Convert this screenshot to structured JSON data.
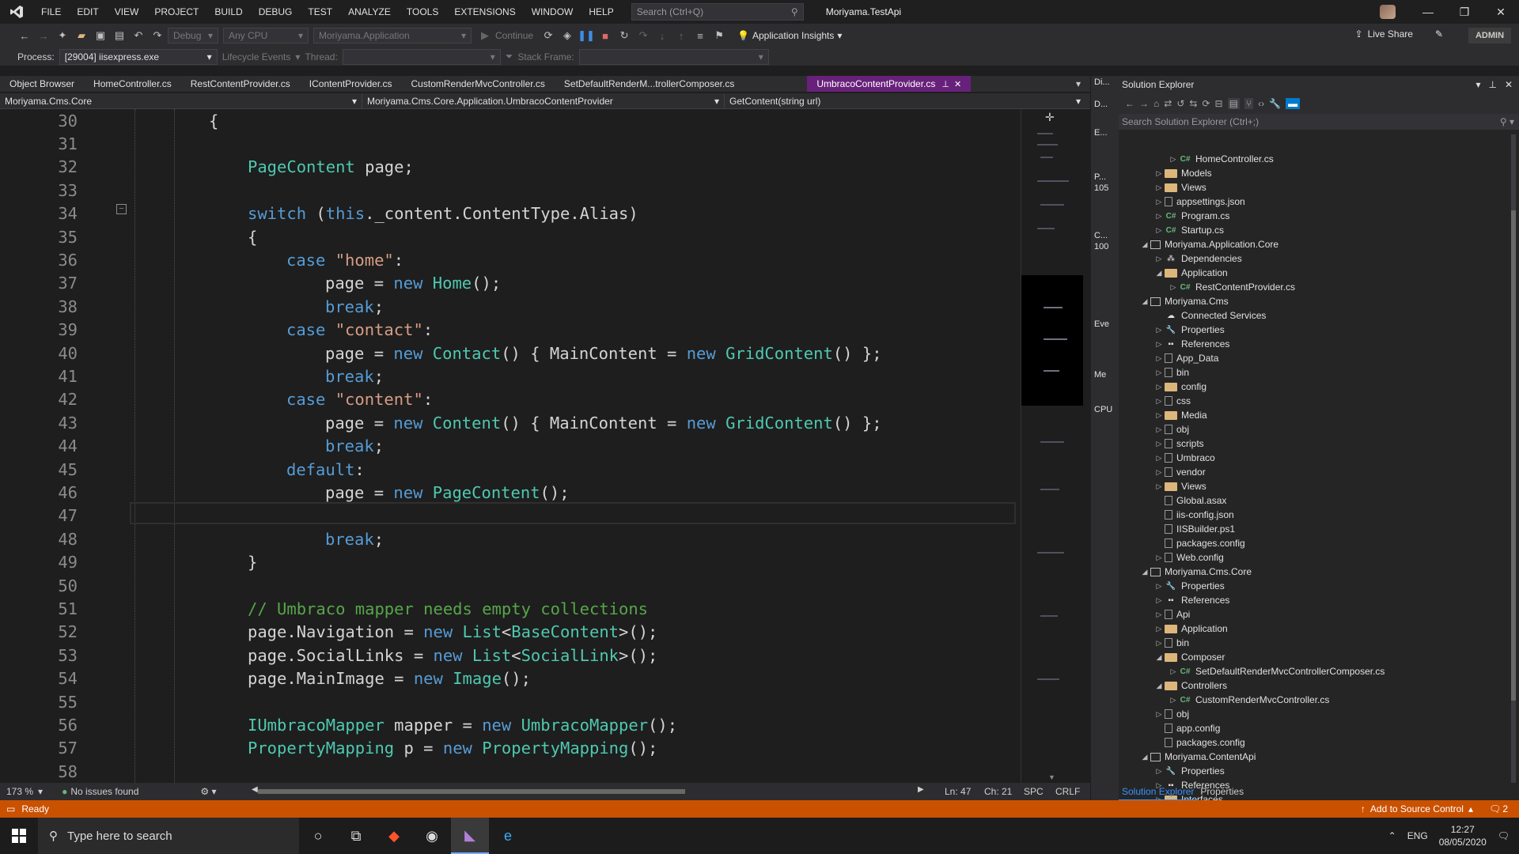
{
  "menu": [
    "FILE",
    "EDIT",
    "VIEW",
    "PROJECT",
    "BUILD",
    "DEBUG",
    "TEST",
    "ANALYZE",
    "TOOLS",
    "EXTENSIONS",
    "WINDOW",
    "HELP"
  ],
  "search_placeholder": "Search (Ctrl+Q)",
  "solution_name": "Moriyama.TestApi",
  "toolbar": {
    "config": "Debug",
    "platform": "Any CPU",
    "startup_project": "Moriyama.Application",
    "continue_label": "Continue",
    "app_insights": "Application Insights",
    "live_share": "Live Share",
    "admin": "ADMIN"
  },
  "debug_toolbar": {
    "process_label": "Process:",
    "process_value": "[29004] iisexpress.exe",
    "lifecycle_label": "Lifecycle Events",
    "thread_label": "Thread:",
    "stack_frame_label": "Stack Frame:"
  },
  "tabs": [
    {
      "label": "Object Browser",
      "active": false
    },
    {
      "label": "HomeController.cs",
      "active": false
    },
    {
      "label": "RestContentProvider.cs",
      "active": false
    },
    {
      "label": "IContentProvider.cs",
      "active": false
    },
    {
      "label": "CustomRenderMvcController.cs",
      "active": false
    },
    {
      "label": "SetDefaultRenderM...trollerComposer.cs",
      "active": false
    },
    {
      "label": "UmbracoContentProvider.cs",
      "active": true
    }
  ],
  "nav": {
    "project": "Moriyama.Cms.Core",
    "type": "Moriyama.Cms.Core.Application.UmbracoContentProvider",
    "member": "GetContent(string url)"
  },
  "code_lines": [
    {
      "n": "30",
      "indent": 0,
      "tokens": [
        {
          "t": "{",
          "c": ""
        }
      ]
    },
    {
      "n": "31",
      "indent": 0,
      "tokens": []
    },
    {
      "n": "32",
      "indent": 1,
      "tokens": [
        {
          "t": "PageContent",
          "c": "ty"
        },
        {
          "t": " page;",
          "c": ""
        }
      ]
    },
    {
      "n": "33",
      "indent": 0,
      "tokens": []
    },
    {
      "n": "34",
      "indent": 1,
      "tokens": [
        {
          "t": "switch",
          "c": "kw"
        },
        {
          "t": " (",
          "c": ""
        },
        {
          "t": "this",
          "c": "kw"
        },
        {
          "t": "._content.ContentType.Alias)",
          "c": ""
        }
      ]
    },
    {
      "n": "35",
      "indent": 1,
      "tokens": [
        {
          "t": "{",
          "c": ""
        }
      ]
    },
    {
      "n": "36",
      "indent": 2,
      "tokens": [
        {
          "t": "case",
          "c": "kw"
        },
        {
          "t": " ",
          "c": ""
        },
        {
          "t": "\"home\"",
          "c": "st"
        },
        {
          "t": ":",
          "c": ""
        }
      ]
    },
    {
      "n": "37",
      "indent": 3,
      "tokens": [
        {
          "t": "page = ",
          "c": ""
        },
        {
          "t": "new",
          "c": "kw"
        },
        {
          "t": " ",
          "c": ""
        },
        {
          "t": "Home",
          "c": "ty"
        },
        {
          "t": "();",
          "c": ""
        }
      ]
    },
    {
      "n": "38",
      "indent": 3,
      "tokens": [
        {
          "t": "break",
          "c": "kw"
        },
        {
          "t": ";",
          "c": ""
        }
      ]
    },
    {
      "n": "39",
      "indent": 2,
      "tokens": [
        {
          "t": "case",
          "c": "kw"
        },
        {
          "t": " ",
          "c": ""
        },
        {
          "t": "\"contact\"",
          "c": "st"
        },
        {
          "t": ":",
          "c": ""
        }
      ]
    },
    {
      "n": "40",
      "indent": 3,
      "tokens": [
        {
          "t": "page = ",
          "c": ""
        },
        {
          "t": "new",
          "c": "kw"
        },
        {
          "t": " ",
          "c": ""
        },
        {
          "t": "Contact",
          "c": "ty"
        },
        {
          "t": "() { MainContent = ",
          "c": ""
        },
        {
          "t": "new",
          "c": "kw"
        },
        {
          "t": " ",
          "c": ""
        },
        {
          "t": "GridContent",
          "c": "ty"
        },
        {
          "t": "() };",
          "c": ""
        }
      ]
    },
    {
      "n": "41",
      "indent": 3,
      "tokens": [
        {
          "t": "break",
          "c": "kw"
        },
        {
          "t": ";",
          "c": ""
        }
      ]
    },
    {
      "n": "42",
      "indent": 2,
      "tokens": [
        {
          "t": "case",
          "c": "kw"
        },
        {
          "t": " ",
          "c": ""
        },
        {
          "t": "\"content\"",
          "c": "st"
        },
        {
          "t": ":",
          "c": ""
        }
      ]
    },
    {
      "n": "43",
      "indent": 3,
      "tokens": [
        {
          "t": "page = ",
          "c": ""
        },
        {
          "t": "new",
          "c": "kw"
        },
        {
          "t": " ",
          "c": ""
        },
        {
          "t": "Content",
          "c": "ty"
        },
        {
          "t": "() { MainContent = ",
          "c": ""
        },
        {
          "t": "new",
          "c": "kw"
        },
        {
          "t": " ",
          "c": ""
        },
        {
          "t": "GridContent",
          "c": "ty"
        },
        {
          "t": "() };",
          "c": ""
        }
      ]
    },
    {
      "n": "44",
      "indent": 3,
      "tokens": [
        {
          "t": "break",
          "c": "kw"
        },
        {
          "t": ";",
          "c": ""
        }
      ]
    },
    {
      "n": "45",
      "indent": 2,
      "tokens": [
        {
          "t": "default",
          "c": "kw"
        },
        {
          "t": ":",
          "c": ""
        }
      ]
    },
    {
      "n": "46",
      "indent": 3,
      "tokens": [
        {
          "t": "page = ",
          "c": ""
        },
        {
          "t": "new",
          "c": "kw"
        },
        {
          "t": " ",
          "c": ""
        },
        {
          "t": "PageContent",
          "c": "ty"
        },
        {
          "t": "();",
          "c": ""
        }
      ]
    },
    {
      "n": "47",
      "indent": 0,
      "tokens": []
    },
    {
      "n": "48",
      "indent": 3,
      "tokens": [
        {
          "t": "break",
          "c": "kw"
        },
        {
          "t": ";",
          "c": ""
        }
      ]
    },
    {
      "n": "49",
      "indent": 1,
      "tokens": [
        {
          "t": "}",
          "c": ""
        }
      ]
    },
    {
      "n": "50",
      "indent": 0,
      "tokens": []
    },
    {
      "n": "51",
      "indent": 1,
      "tokens": [
        {
          "t": "// Umbraco mapper needs empty collections",
          "c": "cm"
        }
      ]
    },
    {
      "n": "52",
      "indent": 1,
      "tokens": [
        {
          "t": "page.Navigation = ",
          "c": ""
        },
        {
          "t": "new",
          "c": "kw"
        },
        {
          "t": " ",
          "c": ""
        },
        {
          "t": "List",
          "c": "ty"
        },
        {
          "t": "<",
          "c": ""
        },
        {
          "t": "BaseContent",
          "c": "ty"
        },
        {
          "t": ">();",
          "c": ""
        }
      ]
    },
    {
      "n": "53",
      "indent": 1,
      "tokens": [
        {
          "t": "page.SocialLinks = ",
          "c": ""
        },
        {
          "t": "new",
          "c": "kw"
        },
        {
          "t": " ",
          "c": ""
        },
        {
          "t": "List",
          "c": "ty"
        },
        {
          "t": "<",
          "c": ""
        },
        {
          "t": "SocialLink",
          "c": "ty"
        },
        {
          "t": ">();",
          "c": ""
        }
      ]
    },
    {
      "n": "54",
      "indent": 1,
      "tokens": [
        {
          "t": "page.MainImage = ",
          "c": ""
        },
        {
          "t": "new",
          "c": "kw"
        },
        {
          "t": " ",
          "c": ""
        },
        {
          "t": "Image",
          "c": "ty"
        },
        {
          "t": "();",
          "c": ""
        }
      ]
    },
    {
      "n": "55",
      "indent": 0,
      "tokens": []
    },
    {
      "n": "56",
      "indent": 1,
      "tokens": [
        {
          "t": "IUmbracoMapper",
          "c": "ty"
        },
        {
          "t": " mapper = ",
          "c": ""
        },
        {
          "t": "new",
          "c": "kw"
        },
        {
          "t": " ",
          "c": ""
        },
        {
          "t": "UmbracoMapper",
          "c": "ty"
        },
        {
          "t": "();",
          "c": ""
        }
      ]
    },
    {
      "n": "57",
      "indent": 1,
      "tokens": [
        {
          "t": "PropertyMapping",
          "c": "ty"
        },
        {
          "t": " p = ",
          "c": ""
        },
        {
          "t": "new",
          "c": "kw"
        },
        {
          "t": " ",
          "c": ""
        },
        {
          "t": "PropertyMapping",
          "c": "ty"
        },
        {
          "t": "();",
          "c": ""
        }
      ]
    },
    {
      "n": "58",
      "indent": 0,
      "tokens": []
    }
  ],
  "editor_status": {
    "zoom": "173 %",
    "issues": "No issues found",
    "ln": "Ln: 47",
    "ch": "Ch: 21",
    "spc": "SPC",
    "crlf": "CRLF"
  },
  "diag_labels": [
    "Di...",
    "D...",
    "E...",
    "P...",
    "105",
    "C...",
    "100",
    "Eve",
    "Me",
    "CPU"
  ],
  "solution_explorer": {
    "title": "Solution Explorer",
    "search_placeholder": "Search Solution Explorer (Ctrl+;)",
    "items": [
      {
        "label": "HomeController.cs",
        "depth": 3,
        "arrow": "right",
        "icon": "cs"
      },
      {
        "label": "Models",
        "depth": 2,
        "arrow": "right",
        "icon": "folder"
      },
      {
        "label": "Views",
        "depth": 2,
        "arrow": "right",
        "icon": "folder"
      },
      {
        "label": "appsettings.json",
        "depth": 2,
        "arrow": "right",
        "icon": "file"
      },
      {
        "label": "Program.cs",
        "depth": 2,
        "arrow": "right",
        "icon": "cs"
      },
      {
        "label": "Startup.cs",
        "depth": 2,
        "arrow": "right",
        "icon": "cs"
      },
      {
        "label": "Moriyama.Application.Core",
        "depth": 1,
        "arrow": "down",
        "icon": "proj"
      },
      {
        "label": "Dependencies",
        "depth": 2,
        "arrow": "right",
        "icon": "deps"
      },
      {
        "label": "Application",
        "depth": 2,
        "arrow": "down",
        "icon": "folder"
      },
      {
        "label": "RestContentProvider.cs",
        "depth": 3,
        "arrow": "right",
        "icon": "cs"
      },
      {
        "label": "Moriyama.Cms",
        "depth": 1,
        "arrow": "down",
        "icon": "proj"
      },
      {
        "label": "Connected Services",
        "depth": 2,
        "arrow": "none",
        "icon": "svc"
      },
      {
        "label": "Properties",
        "depth": 2,
        "arrow": "right",
        "icon": "wrench"
      },
      {
        "label": "References",
        "depth": 2,
        "arrow": "right",
        "icon": "refs"
      },
      {
        "label": "App_Data",
        "depth": 2,
        "arrow": "right",
        "icon": "file"
      },
      {
        "label": "bin",
        "depth": 2,
        "arrow": "right",
        "icon": "file"
      },
      {
        "label": "config",
        "depth": 2,
        "arrow": "right",
        "icon": "folder"
      },
      {
        "label": "css",
        "depth": 2,
        "arrow": "right",
        "icon": "file"
      },
      {
        "label": "Media",
        "depth": 2,
        "arrow": "right",
        "icon": "folder"
      },
      {
        "label": "obj",
        "depth": 2,
        "arrow": "right",
        "icon": "file"
      },
      {
        "label": "scripts",
        "depth": 2,
        "arrow": "right",
        "icon": "file"
      },
      {
        "label": "Umbraco",
        "depth": 2,
        "arrow": "right",
        "icon": "file"
      },
      {
        "label": "vendor",
        "depth": 2,
        "arrow": "right",
        "icon": "file"
      },
      {
        "label": "Views",
        "depth": 2,
        "arrow": "right",
        "icon": "folder"
      },
      {
        "label": "Global.asax",
        "depth": 2,
        "arrow": "none",
        "icon": "file"
      },
      {
        "label": "iis-config.json",
        "depth": 2,
        "arrow": "none",
        "icon": "file"
      },
      {
        "label": "IISBuilder.ps1",
        "depth": 2,
        "arrow": "none",
        "icon": "file"
      },
      {
        "label": "packages.config",
        "depth": 2,
        "arrow": "none",
        "icon": "file"
      },
      {
        "label": "Web.config",
        "depth": 2,
        "arrow": "right",
        "icon": "file"
      },
      {
        "label": "Moriyama.Cms.Core",
        "depth": 1,
        "arrow": "down",
        "icon": "proj"
      },
      {
        "label": "Properties",
        "depth": 2,
        "arrow": "right",
        "icon": "wrench"
      },
      {
        "label": "References",
        "depth": 2,
        "arrow": "right",
        "icon": "refs"
      },
      {
        "label": "Api",
        "depth": 2,
        "arrow": "right",
        "icon": "file"
      },
      {
        "label": "Application",
        "depth": 2,
        "arrow": "right",
        "icon": "folder"
      },
      {
        "label": "bin",
        "depth": 2,
        "arrow": "right",
        "icon": "file"
      },
      {
        "label": "Composer",
        "depth": 2,
        "arrow": "down",
        "icon": "folder"
      },
      {
        "label": "SetDefaultRenderMvcControllerComposer.cs",
        "depth": 3,
        "arrow": "right",
        "icon": "cs"
      },
      {
        "label": "Controllers",
        "depth": 2,
        "arrow": "down",
        "icon": "folder"
      },
      {
        "label": "CustomRenderMvcController.cs",
        "depth": 3,
        "arrow": "right",
        "icon": "cs"
      },
      {
        "label": "obj",
        "depth": 2,
        "arrow": "right",
        "icon": "file"
      },
      {
        "label": "app.config",
        "depth": 2,
        "arrow": "none",
        "icon": "file"
      },
      {
        "label": "packages.config",
        "depth": 2,
        "arrow": "none",
        "icon": "file"
      },
      {
        "label": "Moriyama.ContentApi",
        "depth": 1,
        "arrow": "down",
        "icon": "proj"
      },
      {
        "label": "Properties",
        "depth": 2,
        "arrow": "right",
        "icon": "wrench"
      },
      {
        "label": "References",
        "depth": 2,
        "arrow": "right",
        "icon": "refs"
      },
      {
        "label": "Interfaces",
        "depth": 2,
        "arrow": "right",
        "icon": "folder"
      }
    ],
    "bottom_tabs": [
      "Solution Explorer",
      "Properties"
    ]
  },
  "statusbar": {
    "ready": "Ready",
    "source_control": "Add to Source Control",
    "notifications": "2"
  },
  "taskbar": {
    "search_placeholder": "Type here to search",
    "lang": "ENG",
    "time": "12:27",
    "date": "08/05/2020"
  }
}
